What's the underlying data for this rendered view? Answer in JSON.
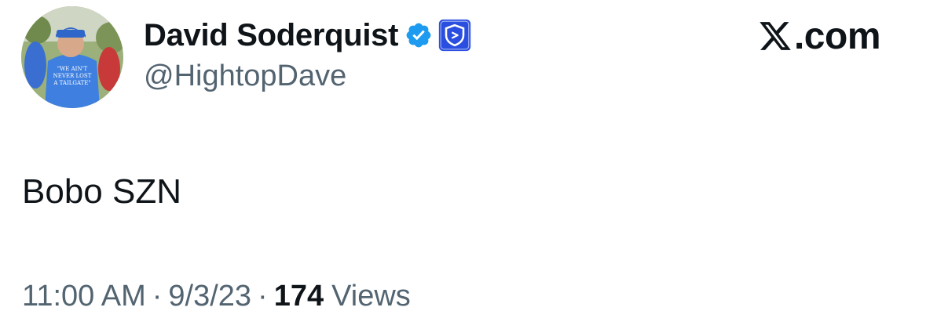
{
  "tweet": {
    "author": {
      "display_name": "David Soderquist",
      "handle": "@HightopDave",
      "verified_badge_color": "#1d9bf0",
      "affiliate_badge_color": "#2a4fe0",
      "avatar_shirt_text": [
        "\"WE AIN'T",
        "NEVER LOST",
        "A TAILGATE\""
      ]
    },
    "brand": {
      "logo_glyph": "𝕏",
      "domain": ".com"
    },
    "text": "Bobo SZN",
    "meta": {
      "time": "11:00 AM",
      "separator": "·",
      "date": "9/3/23",
      "views_count": "174",
      "views_label": "Views"
    }
  }
}
